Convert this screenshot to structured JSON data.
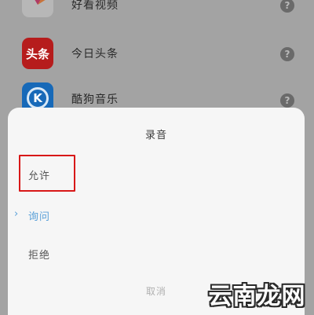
{
  "apps": [
    {
      "id": "haokan",
      "name": "好看视频",
      "icon": "haokan-video-icon"
    },
    {
      "id": "toutiao",
      "name": "今日头条",
      "icon": "toutiao-icon",
      "logo_text": "头条"
    },
    {
      "id": "kugou",
      "name": "酷狗音乐",
      "icon": "kugou-music-icon",
      "logo_text": "K"
    }
  ],
  "help_glyph": "?",
  "dialog": {
    "title": "录音",
    "options": [
      {
        "label": "允许",
        "selected": false,
        "highlighted": true
      },
      {
        "label": "询问",
        "selected": true
      },
      {
        "label": "拒绝",
        "selected": false
      }
    ],
    "selected_marker": "›",
    "cancel_label": "取消"
  },
  "watermark": "云南龙网",
  "colors": {
    "toutiao_red": "#b61c1c",
    "kugou_blue": "#1769b8",
    "selected_blue": "#5aa0d8",
    "highlight_red": "#d81818"
  }
}
